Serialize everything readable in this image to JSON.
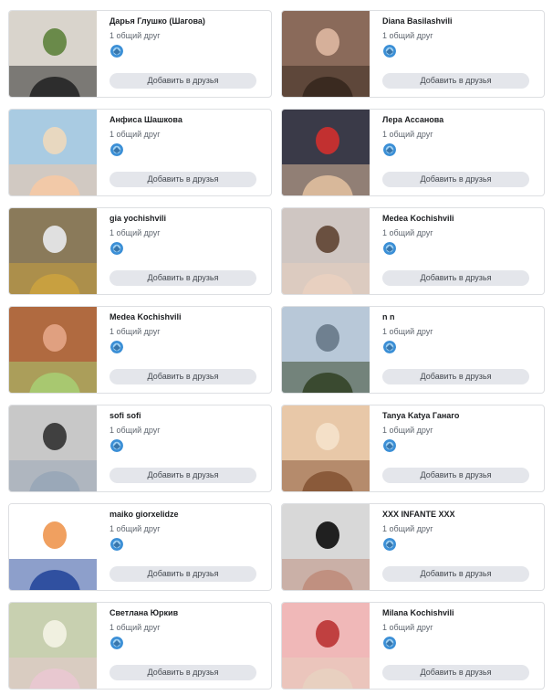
{
  "add_label": "Добавить в друзья",
  "colors": {
    "button_bg": "#e4e6eb",
    "border": "#dddfe2",
    "meta": "#606770"
  },
  "friends": [
    {
      "name": "Дарья Глушко (Шагова)",
      "mutual": "1 общий друг",
      "photo": "woman-motocross-photo"
    },
    {
      "name": "Diana Basilashvili",
      "mutual": "1 общий друг",
      "photo": "woman-portrait-photo"
    },
    {
      "name": "Анфиса Шашкова",
      "mutual": "1 общий друг",
      "photo": "woman-beach-photo"
    },
    {
      "name": "Лера Ассанова",
      "mutual": "1 общий друг",
      "photo": "woman-red-dress-photo"
    },
    {
      "name": "gia yochishvili",
      "mutual": "1 общий друг",
      "photo": "car-street-fruit-photo"
    },
    {
      "name": "Medea Kochishvili",
      "mutual": "1 общий друг",
      "photo": "woman-selfie-photo"
    },
    {
      "name": "Medea Kochishvili",
      "mutual": "1 общий друг",
      "photo": "woman-cafe-drink-photo"
    },
    {
      "name": "n n",
      "mutual": "1 общий друг",
      "photo": "person-seaside-photo"
    },
    {
      "name": "sofi sofi",
      "mutual": "1 общий друг",
      "photo": "woman-venice-photo"
    },
    {
      "name": "Tanya Katya Ганаго",
      "mutual": "1 общий друг",
      "photo": "family-group-photo"
    },
    {
      "name": "maiko giorxelidze",
      "mutual": "1 общий друг",
      "photo": "cartoon-baby-poem-image"
    },
    {
      "name": "XXX INFANTE XXX",
      "mutual": "1 общий друг",
      "photo": "woman-headphones-photo"
    },
    {
      "name": "Светлана Юркив",
      "mutual": "1 общий друг",
      "photo": "roses-bouquet-photo"
    },
    {
      "name": "Milana Kochishvili",
      "mutual": "1 общий друг",
      "photo": "woman-collage-photo"
    }
  ],
  "photo_palettes": [
    [
      "#d9d4cc",
      "#6a8a4a",
      "#2d2d2d"
    ],
    [
      "#8a6a5a",
      "#d6b09a",
      "#3a2a20"
    ],
    [
      "#a9cbe2",
      "#e8d8c0",
      "#f2c9a8"
    ],
    [
      "#3a3a48",
      "#c23030",
      "#d8b89a"
    ],
    [
      "#8a7a5a",
      "#e0e0e0",
      "#c8a040"
    ],
    [
      "#cfc6c2",
      "#6a5040",
      "#e8d0c0"
    ],
    [
      "#b06a40",
      "#e0a080",
      "#a8c870"
    ],
    [
      "#b8c8d8",
      "#6f8090",
      "#3a4a30"
    ],
    [
      "#c8c8c8",
      "#404040",
      "#9aa8b8"
    ],
    [
      "#e8c8a8",
      "#f4e0c8",
      "#8a5a3a"
    ],
    [
      "#ffffff",
      "#f0a060",
      "#3050a0"
    ],
    [
      "#d8d8d8",
      "#202020",
      "#c09080"
    ],
    [
      "#c8d0b0",
      "#f0f0e0",
      "#e8c8d0"
    ],
    [
      "#f0b8b8",
      "#c04040",
      "#e8d0c0"
    ]
  ]
}
